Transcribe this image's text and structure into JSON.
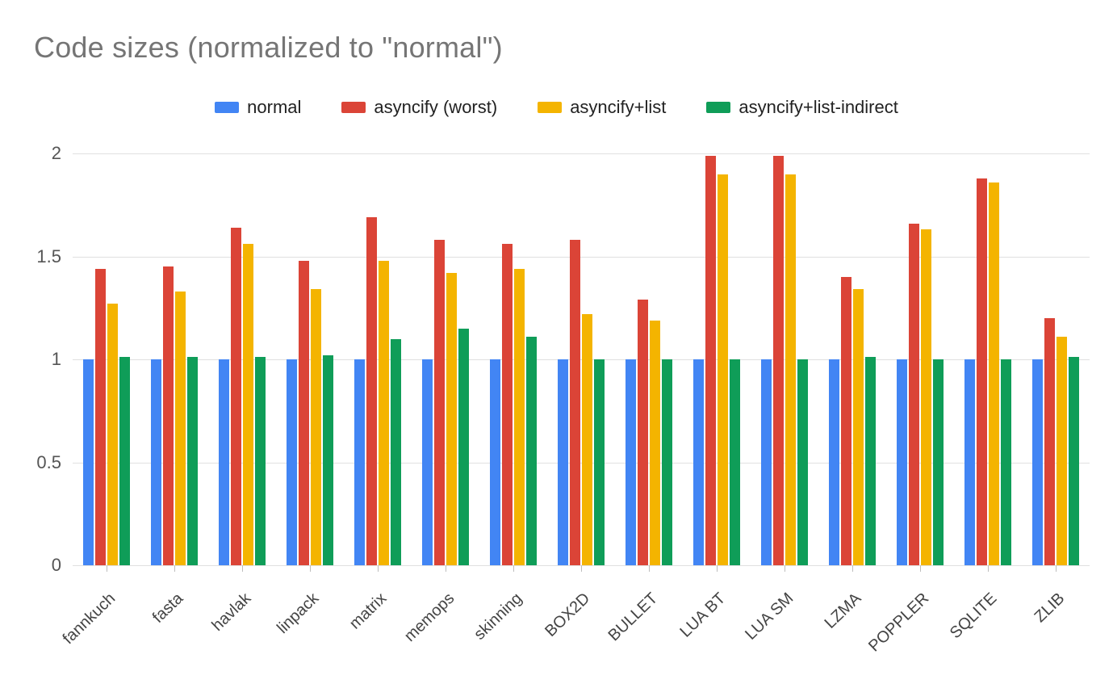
{
  "chart_data": {
    "type": "bar",
    "title": "Code sizes (normalized to \"normal\")",
    "xlabel": "",
    "ylabel": "",
    "ylim": [
      0,
      2
    ],
    "yticks": [
      0,
      0.5,
      1,
      1.5,
      2
    ],
    "categories": [
      "fannkuch",
      "fasta",
      "havlak",
      "linpack",
      "matrix",
      "memops",
      "skinning",
      "BOX2D",
      "BULLET",
      "LUA BT",
      "LUA SM",
      "LZMA",
      "POPPLER",
      "SQLITE",
      "ZLIB"
    ],
    "series": [
      {
        "name": "normal",
        "color": "#4285F4",
        "values": [
          1.0,
          1.0,
          1.0,
          1.0,
          1.0,
          1.0,
          1.0,
          1.0,
          1.0,
          1.0,
          1.0,
          1.0,
          1.0,
          1.0,
          1.0
        ]
      },
      {
        "name": "asyncify (worst)",
        "color": "#DB4437",
        "values": [
          1.44,
          1.45,
          1.64,
          1.48,
          1.69,
          1.58,
          1.56,
          1.58,
          1.29,
          1.99,
          1.99,
          1.4,
          1.66,
          1.88,
          1.2
        ]
      },
      {
        "name": "asyncify+list",
        "color": "#F4B400",
        "values": [
          1.27,
          1.33,
          1.56,
          1.34,
          1.48,
          1.42,
          1.44,
          1.22,
          1.19,
          1.9,
          1.9,
          1.34,
          1.63,
          1.86,
          1.11
        ]
      },
      {
        "name": "asyncify+list-indirect",
        "color": "#0F9D58",
        "values": [
          1.01,
          1.01,
          1.01,
          1.02,
          1.1,
          1.15,
          1.11,
          1.0,
          1.0,
          1.0,
          1.0,
          1.01,
          1.0,
          1.0,
          1.01
        ]
      }
    ]
  }
}
